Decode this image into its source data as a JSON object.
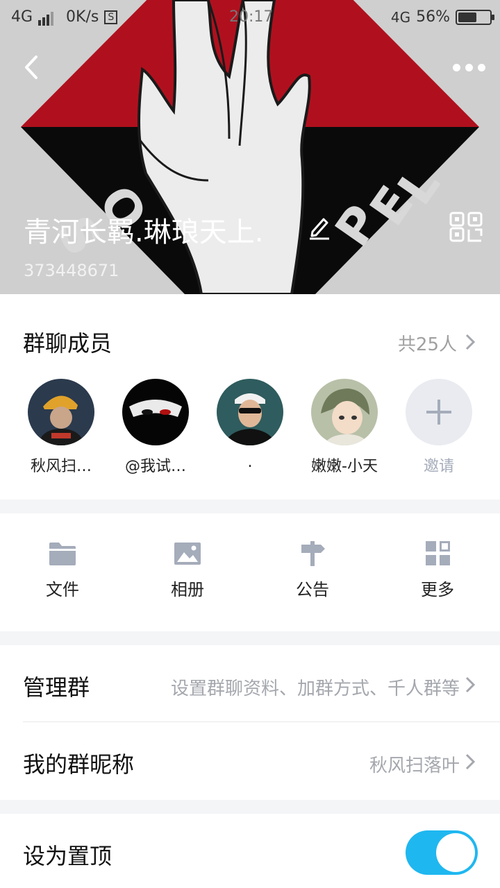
{
  "status_bar": {
    "network": "4G",
    "speed": "0K/s",
    "time": "20:17",
    "network_right": "4G",
    "battery": "56%"
  },
  "group": {
    "name": "青河长羁.琳琅天上.",
    "id": "373448671"
  },
  "members": {
    "title": "群聊成员",
    "count": "共25人",
    "list": [
      {
        "name": "秋风扫…"
      },
      {
        "name": "@我试…"
      },
      {
        "name": "."
      },
      {
        "name": "嫩嫩-小天"
      }
    ],
    "invite_label": "邀请"
  },
  "tools": [
    {
      "label": "文件",
      "icon": "folder-icon"
    },
    {
      "label": "相册",
      "icon": "photo-icon"
    },
    {
      "label": "公告",
      "icon": "signpost-icon"
    },
    {
      "label": "更多",
      "icon": "grid-icon"
    }
  ],
  "settings": {
    "manage_label": "管理群",
    "manage_hint": "设置群聊资料、加群方式、千人群等",
    "nickname_label": "我的群昵称",
    "nickname_value": "秋风扫落叶",
    "pin_label": "设为置顶",
    "pin_enabled": true
  },
  "colors": {
    "accent": "#1fb7f0",
    "icon_gray": "#a5acba",
    "header_red": "#b0101e"
  }
}
